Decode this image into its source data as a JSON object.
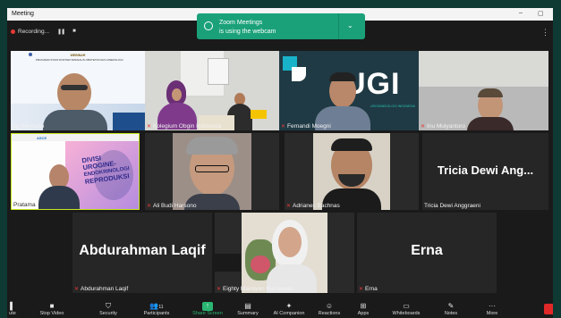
{
  "window": {
    "title": "Meeting",
    "recording_label": "Recording...",
    "pause_glyph": "❚❚",
    "stop_glyph": "■",
    "minimize_glyph": "–",
    "restore_glyph": "▢"
  },
  "toast": {
    "line1": "Zoom Meetings",
    "line2": "is using the webcam",
    "chevron": "⌄"
  },
  "participants": [
    {
      "name": "dy Hendarto"
    },
    {
      "name": "Kolegium Obgin Indonesia"
    },
    {
      "name": "Fernandi Moegni"
    },
    {
      "name": "Inu Mulyantoro"
    },
    {
      "name": "Pratama"
    },
    {
      "name": "Ali Budi Harsono"
    },
    {
      "name": "Adrianes Bachnas"
    },
    {
      "name": "Tricia Dewi Anggraeni",
      "big": "Tricia Dewi Ang..."
    },
    {
      "name": "Abdurahman Laqif",
      "big": "Abdurahman Laqif"
    },
    {
      "name": "Eighty Mardiyan Kurniawati"
    },
    {
      "name": "Erna",
      "big": "Erna"
    }
  ],
  "slide1": {
    "heading": "WEBINAR",
    "sub": "PROGRAM STUDI DOKTER SPESIALIS OBSTETRI DAN GINEKOLOGI"
  },
  "slide2": {
    "title_lines": [
      "DIVISI",
      "UROGINE-",
      "ENDOKRINOLOGI",
      "REPRODUKSI"
    ]
  },
  "brand": {
    "letters": "UGI",
    "tag": "UROGINEKOLOGI INDONESIA"
  },
  "toolbar": [
    {
      "label": "ute",
      "icon": "mic-icon"
    },
    {
      "label": "Stop Video",
      "icon": "video-icon"
    },
    {
      "label": "Security",
      "icon": "shield-icon"
    },
    {
      "label": "Participants",
      "icon": "people-icon",
      "count": "11"
    },
    {
      "label": "Share Screen",
      "icon": "share-icon"
    },
    {
      "label": "Summary",
      "icon": "summary-icon"
    },
    {
      "label": "AI Companion",
      "icon": "sparkle-icon"
    },
    {
      "label": "Reactions",
      "icon": "reaction-icon"
    },
    {
      "label": "Apps",
      "icon": "apps-icon"
    },
    {
      "label": "Whiteboards",
      "icon": "whiteboard-icon"
    },
    {
      "label": "Notes",
      "icon": "notes-icon"
    },
    {
      "label": "More",
      "icon": "more-icon"
    }
  ],
  "colors": {
    "accent": "#1aa179",
    "active_speaker": "#c8e61e",
    "mute": "#e53935",
    "share": "#2bb673"
  }
}
